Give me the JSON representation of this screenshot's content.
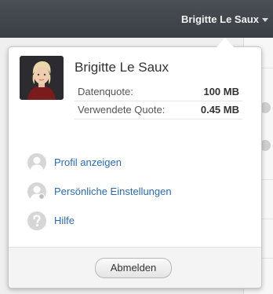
{
  "header": {
    "user_name": "Brigitte Le Saux"
  },
  "profile": {
    "name": "Brigitte Le Saux",
    "quota": [
      {
        "label": "Datenquote:",
        "value": "100 MB"
      },
      {
        "label": "Verwendete Quote:",
        "value": "0.45 MB"
      }
    ]
  },
  "menu": {
    "items": [
      {
        "label": "Profil anzeigen",
        "icon": "person-icon"
      },
      {
        "label": "Persönliche Einstellungen",
        "icon": "person-settings-icon"
      },
      {
        "label": "Hilfe",
        "icon": "help-icon"
      }
    ]
  },
  "footer": {
    "logout_label": "Abmelden"
  },
  "colors": {
    "link": "#2a6ab4",
    "topbar": "#3f444a"
  }
}
